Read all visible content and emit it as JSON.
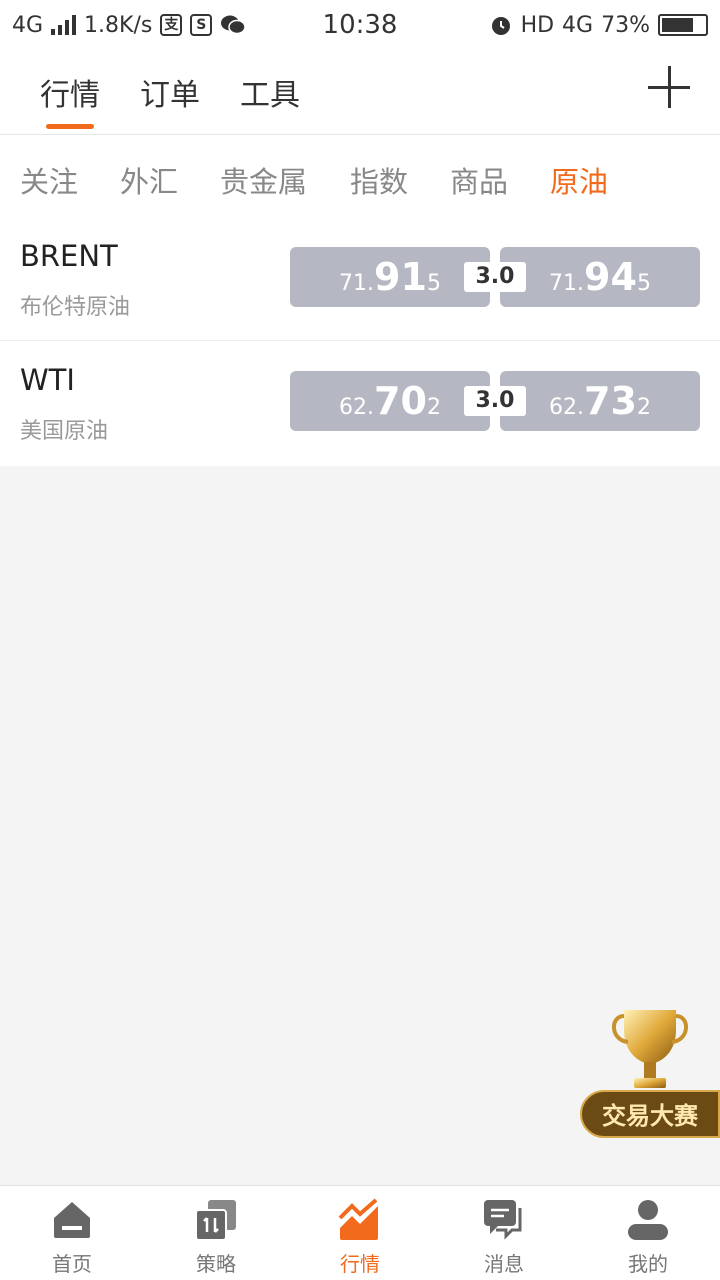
{
  "status_bar": {
    "network": "4G",
    "speed": "1.8K/s",
    "app_icons": [
      "alipay-icon",
      "s-icon",
      "wechat-icon"
    ],
    "time": "10:38",
    "hd": "HD",
    "network_right": "4G",
    "battery_percent": "73%",
    "battery_level": 0.73
  },
  "top_nav": {
    "tabs": [
      "行情",
      "订单",
      "工具"
    ],
    "active_index": 0
  },
  "sub_tabs": {
    "items": [
      "关注",
      "外汇",
      "贵金属",
      "指数",
      "商品",
      "原油"
    ],
    "active_index": 5
  },
  "quotes": [
    {
      "symbol": "BRENT",
      "name": "布伦特原油",
      "bid": {
        "prefix": "71.",
        "main": "91",
        "suffix": "5"
      },
      "spread": "3.0",
      "ask": {
        "prefix": "71.",
        "main": "94",
        "suffix": "5"
      }
    },
    {
      "symbol": "WTI",
      "name": "美国原油",
      "bid": {
        "prefix": "62.",
        "main": "70",
        "suffix": "2"
      },
      "spread": "3.0",
      "ask": {
        "prefix": "62.",
        "main": "73",
        "suffix": "2"
      }
    }
  ],
  "contest_badge": {
    "label": "交易大赛"
  },
  "bottom_nav": {
    "items": [
      {
        "label": "首页",
        "icon": "home-icon"
      },
      {
        "label": "策略",
        "icon": "strategy-icon"
      },
      {
        "label": "行情",
        "icon": "chart-icon"
      },
      {
        "label": "消息",
        "icon": "message-icon"
      },
      {
        "label": "我的",
        "icon": "profile-icon"
      }
    ],
    "active_index": 2
  },
  "colors": {
    "accent": "#f26a1b",
    "price_box": "#b5b8c2",
    "background": "#f4f4f4"
  }
}
